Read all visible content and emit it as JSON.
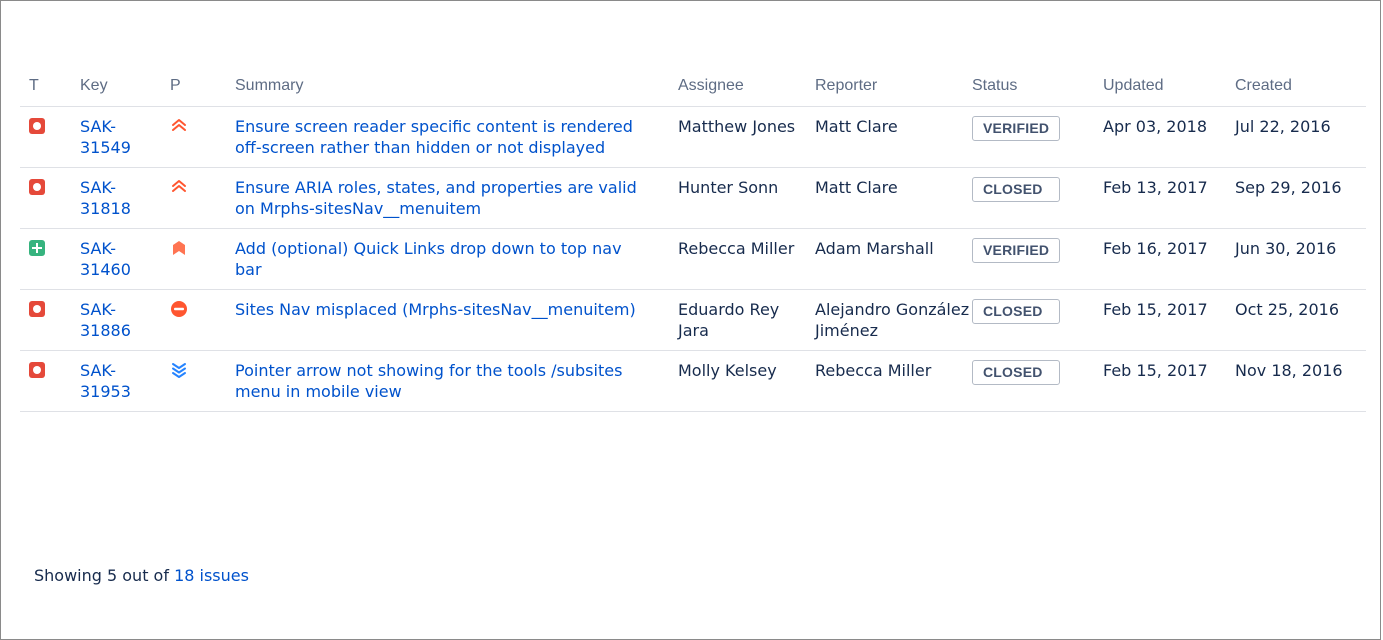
{
  "columns": {
    "type": "T",
    "key": "Key",
    "priority": "P",
    "summary": "Summary",
    "assignee": "Assignee",
    "reporter": "Reporter",
    "status": "Status",
    "updated": "Updated",
    "created": "Created"
  },
  "issues": [
    {
      "type_icon": "bug-icon",
      "key_line1": "SAK-",
      "key_line2": "31549",
      "priority_icon": "priority-critical-icon",
      "summary": "Ensure screen reader specific content is rendered off-screen rather than hidden or not displayed",
      "assignee": "Matthew Jones",
      "reporter": "Matt Clare",
      "status": "VERIFIED",
      "updated": "Apr 03, 2018",
      "created": "Jul 22, 2016"
    },
    {
      "type_icon": "bug-icon",
      "key_line1": "SAK-",
      "key_line2": "31818",
      "priority_icon": "priority-critical-icon",
      "summary": "Ensure ARIA roles, states, and properties are valid on Mrphs-sitesNav__menuitem",
      "assignee": "Hunter Sonn",
      "reporter": "Matt Clare",
      "status": "CLOSED",
      "updated": "Feb 13, 2017",
      "created": "Sep 29, 2016"
    },
    {
      "type_icon": "new-feature-icon",
      "key_line1": "SAK-",
      "key_line2": "31460",
      "priority_icon": "priority-major-icon",
      "summary": "Add (optional) Quick Links drop down to top nav bar",
      "assignee": "Rebecca Miller",
      "reporter": "Adam Marshall",
      "status": "VERIFIED",
      "updated": "Feb 16, 2017",
      "created": "Jun 30, 2016"
    },
    {
      "type_icon": "bug-icon",
      "key_line1": "SAK-",
      "key_line2": "31886",
      "priority_icon": "priority-blocker-icon",
      "summary": "Sites Nav misplaced (Mrphs-sitesNav__menuitem)",
      "assignee": "Eduardo Rey Jara",
      "reporter": "Alejandro González Jiménez",
      "status": "CLOSED",
      "updated": "Feb 15, 2017",
      "created": "Oct 25, 2016"
    },
    {
      "type_icon": "bug-icon",
      "key_line1": "SAK-",
      "key_line2": "31953",
      "priority_icon": "priority-minor-icon",
      "summary": "Pointer arrow not showing for the tools /subsites menu in mobile view",
      "assignee": "Molly Kelsey",
      "reporter": "Rebecca Miller",
      "status": "CLOSED",
      "updated": "Feb 15, 2017",
      "created": "Nov 18, 2016"
    }
  ],
  "footer": {
    "prefix": "Showing 5 out of",
    "link": "18 issues"
  },
  "colors": {
    "link": "#0052cc",
    "bug": "#e5493a",
    "new_feature": "#36b37e",
    "priority_high": "#ff5630",
    "priority_minor": "#2684ff"
  }
}
